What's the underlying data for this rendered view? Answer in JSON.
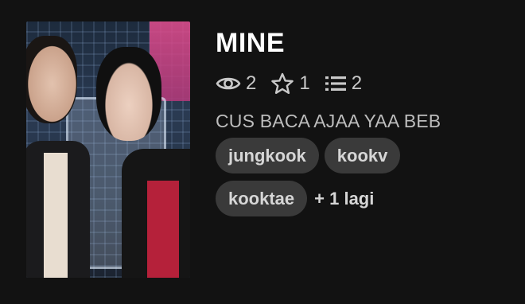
{
  "story": {
    "title": "MINE",
    "description": "CUS BACA AJAA YAA BEB",
    "stats": {
      "views": "2",
      "votes": "1",
      "parts": "2"
    },
    "tags": [
      "jungkook",
      "kookv",
      "kooktae"
    ],
    "more_tags": "+ 1 lagi",
    "icons": {
      "views": "eye-icon",
      "votes": "star-icon",
      "parts": "list-icon"
    }
  }
}
